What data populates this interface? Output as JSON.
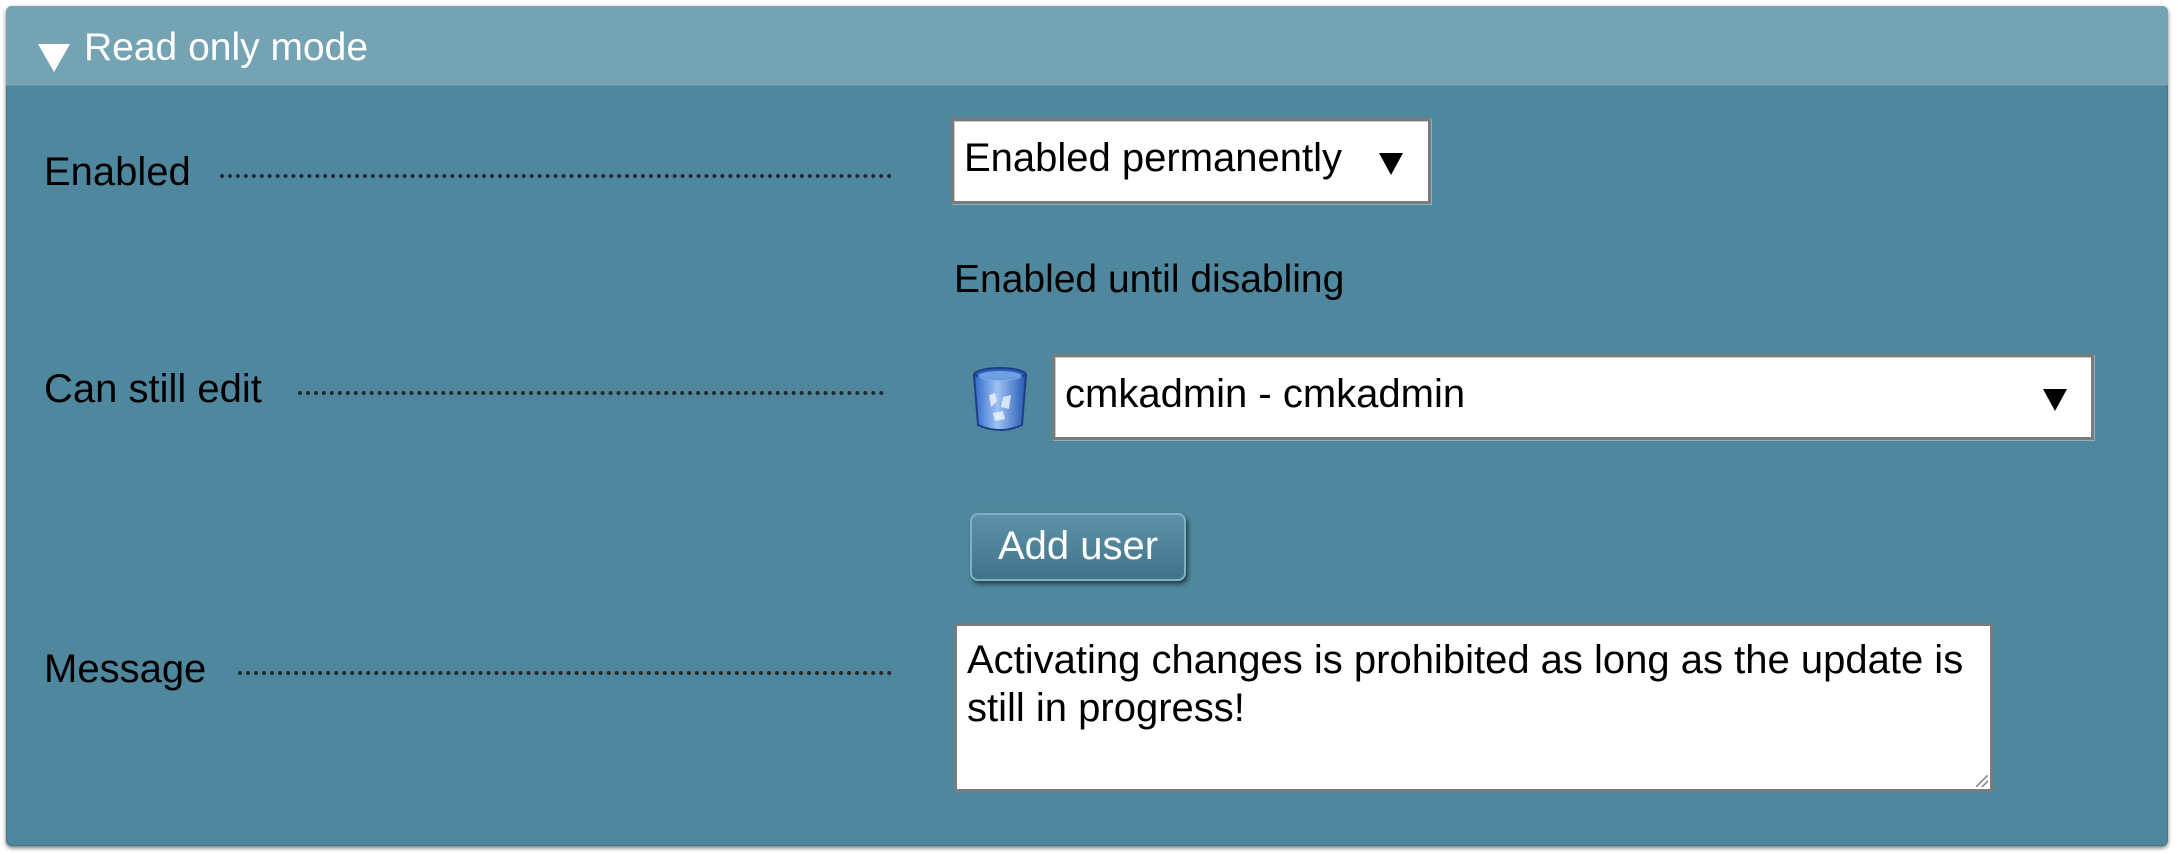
{
  "section": {
    "title": "Read only mode",
    "expanded": true
  },
  "colors": {
    "panel_background": "#4f889e",
    "header_background": "#74a3b4",
    "button_background": "#4a8098"
  },
  "fields": {
    "enabled": {
      "label": "Enabled",
      "selected": "Enabled permanently",
      "hint": "Enabled until disabling"
    },
    "can_still_edit": {
      "label": "Can still edit",
      "users": [
        {
          "selected": "cmkadmin - cmkadmin",
          "remove_icon": "trash-icon"
        }
      ],
      "add_button": "Add user"
    },
    "message": {
      "label": "Message",
      "value": "Activating changes is prohibited as long as the update is still in progress!"
    }
  }
}
